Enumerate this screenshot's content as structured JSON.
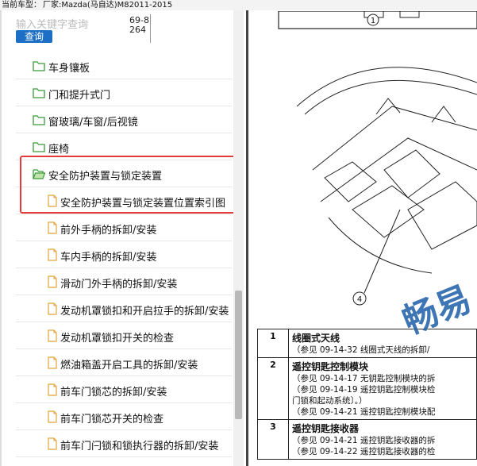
{
  "header": {
    "vehicle_prefix": "当前车型：",
    "vehicle": "厂家:Mazda(马自达)M82011-2015"
  },
  "search": {
    "placeholder": "输入关键字查询",
    "button_label": "查询",
    "phone": "69-8264"
  },
  "tree": [
    {
      "label": "车身镶板",
      "type": "folder"
    },
    {
      "label": "门和提升式门",
      "type": "folder"
    },
    {
      "label": "窗玻璃/车窗/后视镜",
      "type": "folder"
    },
    {
      "label": "座椅",
      "type": "folder"
    },
    {
      "label": "安全防护装置与锁定装置",
      "type": "folder-open"
    },
    {
      "label": "安全防护装置与锁定装置位置索引图",
      "type": "doc"
    },
    {
      "label": "前外手柄的拆卸/安装",
      "type": "doc"
    },
    {
      "label": "车内手柄的拆卸/安装",
      "type": "doc"
    },
    {
      "label": "滑动门外手柄的拆卸/安装",
      "type": "doc"
    },
    {
      "label": "发动机罩锁扣和开启拉手的拆卸/安装",
      "type": "doc"
    },
    {
      "label": "发动机罩锁扣开关的检查",
      "type": "doc"
    },
    {
      "label": "燃油箱盖开启工具的拆卸/安装",
      "type": "doc"
    },
    {
      "label": "前车门锁芯的拆卸/安装",
      "type": "doc"
    },
    {
      "label": "前车门锁芯开关的检查",
      "type": "doc"
    },
    {
      "label": "前车门闩锁和锁执行器的拆卸/安装",
      "type": "doc"
    }
  ],
  "figure": {
    "callout_top": "1",
    "callout_bottom": "4"
  },
  "table": [
    {
      "num": "1",
      "title": "线圈式天线",
      "refs": [
        "（参见 09-14-32 线圈式天线的拆卸/"
      ]
    },
    {
      "num": "2",
      "title": "遥控钥匙控制模块",
      "refs": [
        "（参见 09-14-17 无钥匙控制模块的拆",
        "（参见 09-14-19 遥控钥匙控制模块检",
        "门锁和起动系统〕。）",
        "（参见 09-14-21 遥控钥匙控制模块配"
      ]
    },
    {
      "num": "3",
      "title": "遥控钥匙接收器",
      "refs": [
        "（参见 09-14-21 遥控钥匙接收器的拆",
        "（参见 09-14-22 遥控钥匙接收器的检"
      ]
    }
  ],
  "watermark": "畅易",
  "colors": {
    "accent": "#1c6fc4",
    "highlight": "#e23b3b",
    "folder": "#3a9a3a",
    "doc": "#e3a43b"
  }
}
